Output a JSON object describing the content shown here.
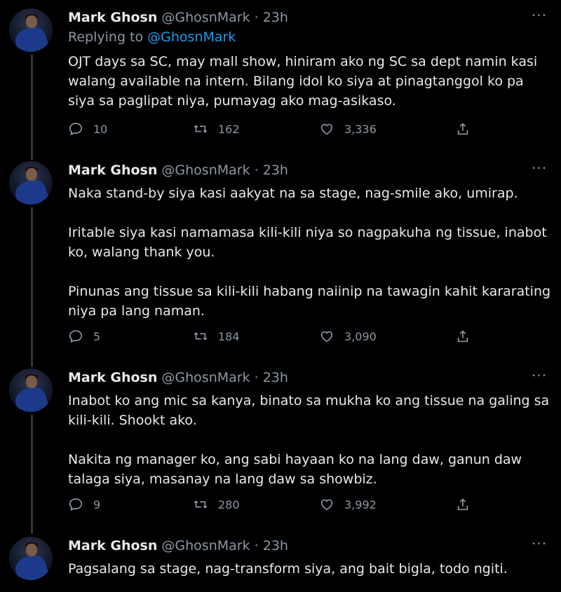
{
  "tweets": [
    {
      "name": "Mark Ghosn",
      "handle": "@GhosnMark",
      "dot": "·",
      "time": "23h",
      "reply_prefix": "Replying to ",
      "reply_handle": "@GhosnMark",
      "paragraphs": [
        "OJT days sa SC, may mall show, hiniram ako ng SC sa dept namin kasi walang available na intern. Bilang idol ko siya at pinagtanggol ko pa siya sa paglipat niya, pumayag ako mag-asikaso."
      ],
      "replies": "10",
      "retweets": "162",
      "likes": "3,336"
    },
    {
      "name": "Mark Ghosn",
      "handle": "@GhosnMark",
      "dot": "·",
      "time": "23h",
      "paragraphs": [
        "Naka stand-by siya kasi aakyat na sa stage, nag-smile ako, umirap.",
        "Iritable siya kasi namamasa kili-kili niya so nagpakuha ng tissue, inabot ko, walang thank you.",
        "Pinunas ang tissue sa kili-kili habang naiinip na tawagin kahit kararating niya pa lang naman."
      ],
      "replies": "5",
      "retweets": "184",
      "likes": "3,090"
    },
    {
      "name": "Mark Ghosn",
      "handle": "@GhosnMark",
      "dot": "·",
      "time": "23h",
      "paragraphs": [
        "Inabot ko ang mic sa kanya, binato sa mukha ko ang tissue na galing sa kili-kili. Shookt ako.",
        "Nakita ng manager ko, ang sabi hayaan ko na lang daw, ganun daw talaga siya, masanay na lang daw sa showbiz."
      ],
      "replies": "9",
      "retweets": "280",
      "likes": "3,992"
    },
    {
      "name": "Mark Ghosn",
      "handle": "@GhosnMark",
      "dot": "·",
      "time": "23h",
      "paragraphs": [
        "Pagsalang sa stage, nag-transform siya, ang bait bigla, todo ngiti."
      ]
    }
  ],
  "more_glyph": "···",
  "icons": {
    "reply": "reply-icon",
    "retweet": "retweet-icon",
    "like": "like-icon",
    "share": "share-icon",
    "more": "more-icon"
  },
  "colors": {
    "background": "#000000",
    "text": "#e7e9ea",
    "muted": "#8b98a5",
    "link": "#1d9bf0",
    "thread_line": "#333639"
  }
}
